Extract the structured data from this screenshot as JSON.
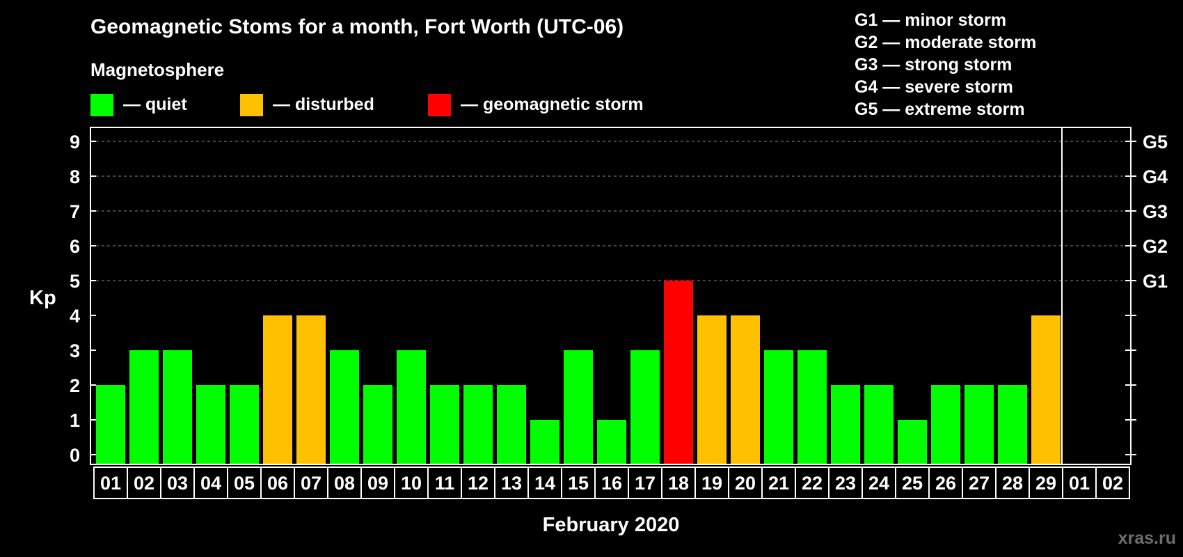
{
  "colors": {
    "background": "#000000",
    "foreground": "#ffffff",
    "quiet": "#00ff00",
    "disturbed": "#ffc000",
    "storm": "#ff0000",
    "grid": "#888888",
    "watermark": "#6e6e6e"
  },
  "header": {
    "title": "Geomagnetic Stoms for a month, Fort Worth (UTC-06)",
    "subtitle": "Magnetosphere",
    "legend": [
      {
        "label": "— quiet",
        "color": "#00ff00"
      },
      {
        "label": "— disturbed",
        "color": "#ffc000"
      },
      {
        "label": "— geomagnetic storm",
        "color": "#ff0000"
      }
    ],
    "storm_levels": [
      "G1 — minor storm",
      "G2 — moderate storm",
      "G3 — strong storm",
      "G4 — severe storm",
      "G5 — extreme storm"
    ]
  },
  "watermark": "xras.ru",
  "chart_data": {
    "type": "bar",
    "ylabel": "Kp",
    "xlabel": "February 2020",
    "ylim": [
      0,
      9
    ],
    "yticks": [
      "0",
      "1",
      "2",
      "3",
      "4",
      "5",
      "6",
      "7",
      "8",
      "9"
    ],
    "right_ticks": [
      {
        "value": 5,
        "label": "G1"
      },
      {
        "value": 6,
        "label": "G2"
      },
      {
        "value": 7,
        "label": "G3"
      },
      {
        "value": 8,
        "label": "G4"
      },
      {
        "value": 9,
        "label": "G5"
      }
    ],
    "grid": "dashed horizontal lines at Kp 5-9",
    "categories": [
      "01",
      "02",
      "03",
      "04",
      "05",
      "06",
      "07",
      "08",
      "09",
      "10",
      "11",
      "12",
      "13",
      "14",
      "15",
      "16",
      "17",
      "18",
      "19",
      "20",
      "21",
      "22",
      "23",
      "24",
      "25",
      "26",
      "27",
      "28",
      "29",
      "01",
      "02"
    ],
    "values": [
      2,
      3,
      3,
      2,
      2,
      4,
      4,
      3,
      2,
      3,
      2,
      2,
      2,
      1,
      3,
      1,
      3,
      5,
      4,
      4,
      3,
      3,
      2,
      2,
      1,
      2,
      2,
      2,
      4,
      null,
      null
    ],
    "status": [
      "quiet",
      "quiet",
      "quiet",
      "quiet",
      "quiet",
      "disturbed",
      "disturbed",
      "quiet",
      "quiet",
      "quiet",
      "quiet",
      "quiet",
      "quiet",
      "quiet",
      "quiet",
      "quiet",
      "quiet",
      "storm",
      "disturbed",
      "disturbed",
      "quiet",
      "quiet",
      "quiet",
      "quiet",
      "quiet",
      "quiet",
      "quiet",
      "quiet",
      "disturbed",
      null,
      null
    ],
    "month_boundary_after_index": 28
  }
}
